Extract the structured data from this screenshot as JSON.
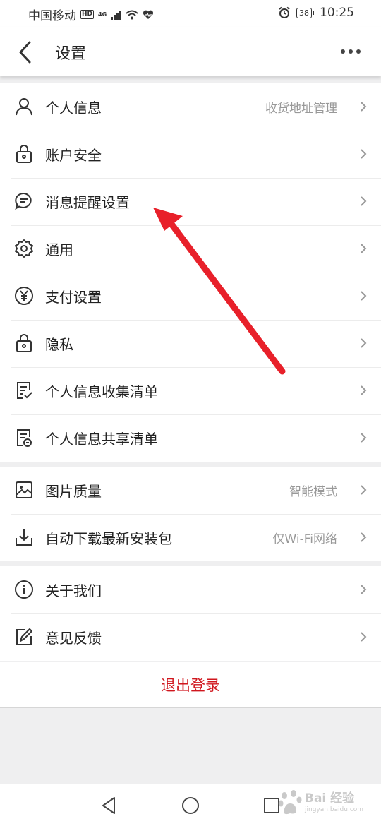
{
  "status_bar": {
    "carrier": "中国移动",
    "hd": "HD",
    "network": "4G",
    "battery": "38",
    "time": "10:25"
  },
  "header": {
    "title": "设置",
    "back_icon": "chevron-left-icon",
    "more_icon": "more-horizontal-icon"
  },
  "group1": [
    {
      "label": "个人信息",
      "value": "收货地址管理",
      "icon": "user-icon"
    },
    {
      "label": "账户安全",
      "value": "",
      "icon": "lock-icon"
    },
    {
      "label": "消息提醒设置",
      "value": "",
      "icon": "message-icon"
    },
    {
      "label": "通用",
      "value": "",
      "icon": "gear-icon"
    },
    {
      "label": "支付设置",
      "value": "",
      "icon": "yuan-icon"
    },
    {
      "label": "隐私",
      "value": "",
      "icon": "privacy-lock-icon"
    },
    {
      "label": "个人信息收集清单",
      "value": "",
      "icon": "checklist-icon"
    },
    {
      "label": "个人信息共享清单",
      "value": "",
      "icon": "share-list-icon"
    }
  ],
  "group2": [
    {
      "label": "图片质量",
      "value": "智能模式",
      "icon": "image-icon"
    },
    {
      "label": "自动下载最新安装包",
      "value": "仅Wi-Fi网络",
      "icon": "download-icon"
    }
  ],
  "group3": [
    {
      "label": "关于我们",
      "value": "",
      "icon": "info-icon"
    },
    {
      "label": "意见反馈",
      "value": "",
      "icon": "feedback-icon"
    }
  ],
  "logout": {
    "label": "退出登录"
  },
  "colors": {
    "accent_red": "#d0171e",
    "arrow_red": "#e8202a"
  },
  "watermark": {
    "brand": "Bai 经验",
    "sub": "jingyan.baidu.com"
  }
}
